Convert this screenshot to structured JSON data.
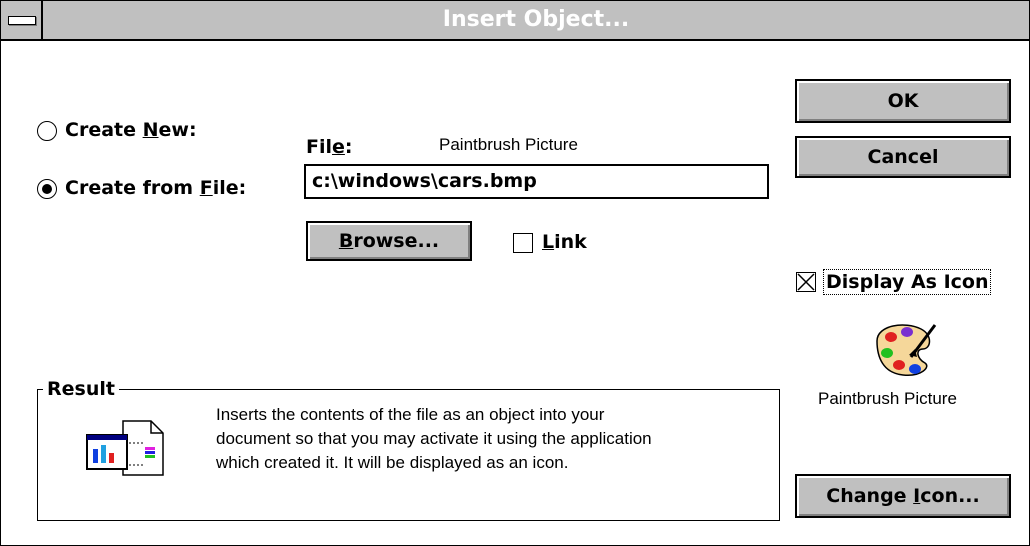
{
  "window": {
    "title": "Insert Object..."
  },
  "options": {
    "create_new_prefix": "Create ",
    "create_new_key": "N",
    "create_new_suffix": "ew:",
    "create_from_file_prefix": "Create from ",
    "create_from_file_key": "F",
    "create_from_file_suffix": "ile:",
    "selected": "create_from_file"
  },
  "file": {
    "label_prefix": "Fil",
    "label_key": "e",
    "label_suffix": ":",
    "type": "Paintbrush Picture",
    "value": "c:\\windows\\cars.bmp"
  },
  "buttons": {
    "ok": "OK",
    "cancel": "Cancel",
    "browse_key": "B",
    "browse_rest": "rowse...",
    "change_icon_prefix": "Change ",
    "change_icon_key": "I",
    "change_icon_suffix": "con..."
  },
  "link": {
    "key": "L",
    "rest": "ink",
    "checked": false
  },
  "display_as_icon": {
    "label": "Display As Icon",
    "checked": true
  },
  "icon": {
    "name": "paintbrush-palette-icon",
    "caption": "Paintbrush Picture"
  },
  "result": {
    "title": "Result",
    "line1": "Inserts the contents of the file as an object into your",
    "line2": "document so that you may activate it using the application",
    "line3": "which created it.  It will be displayed as an icon."
  }
}
